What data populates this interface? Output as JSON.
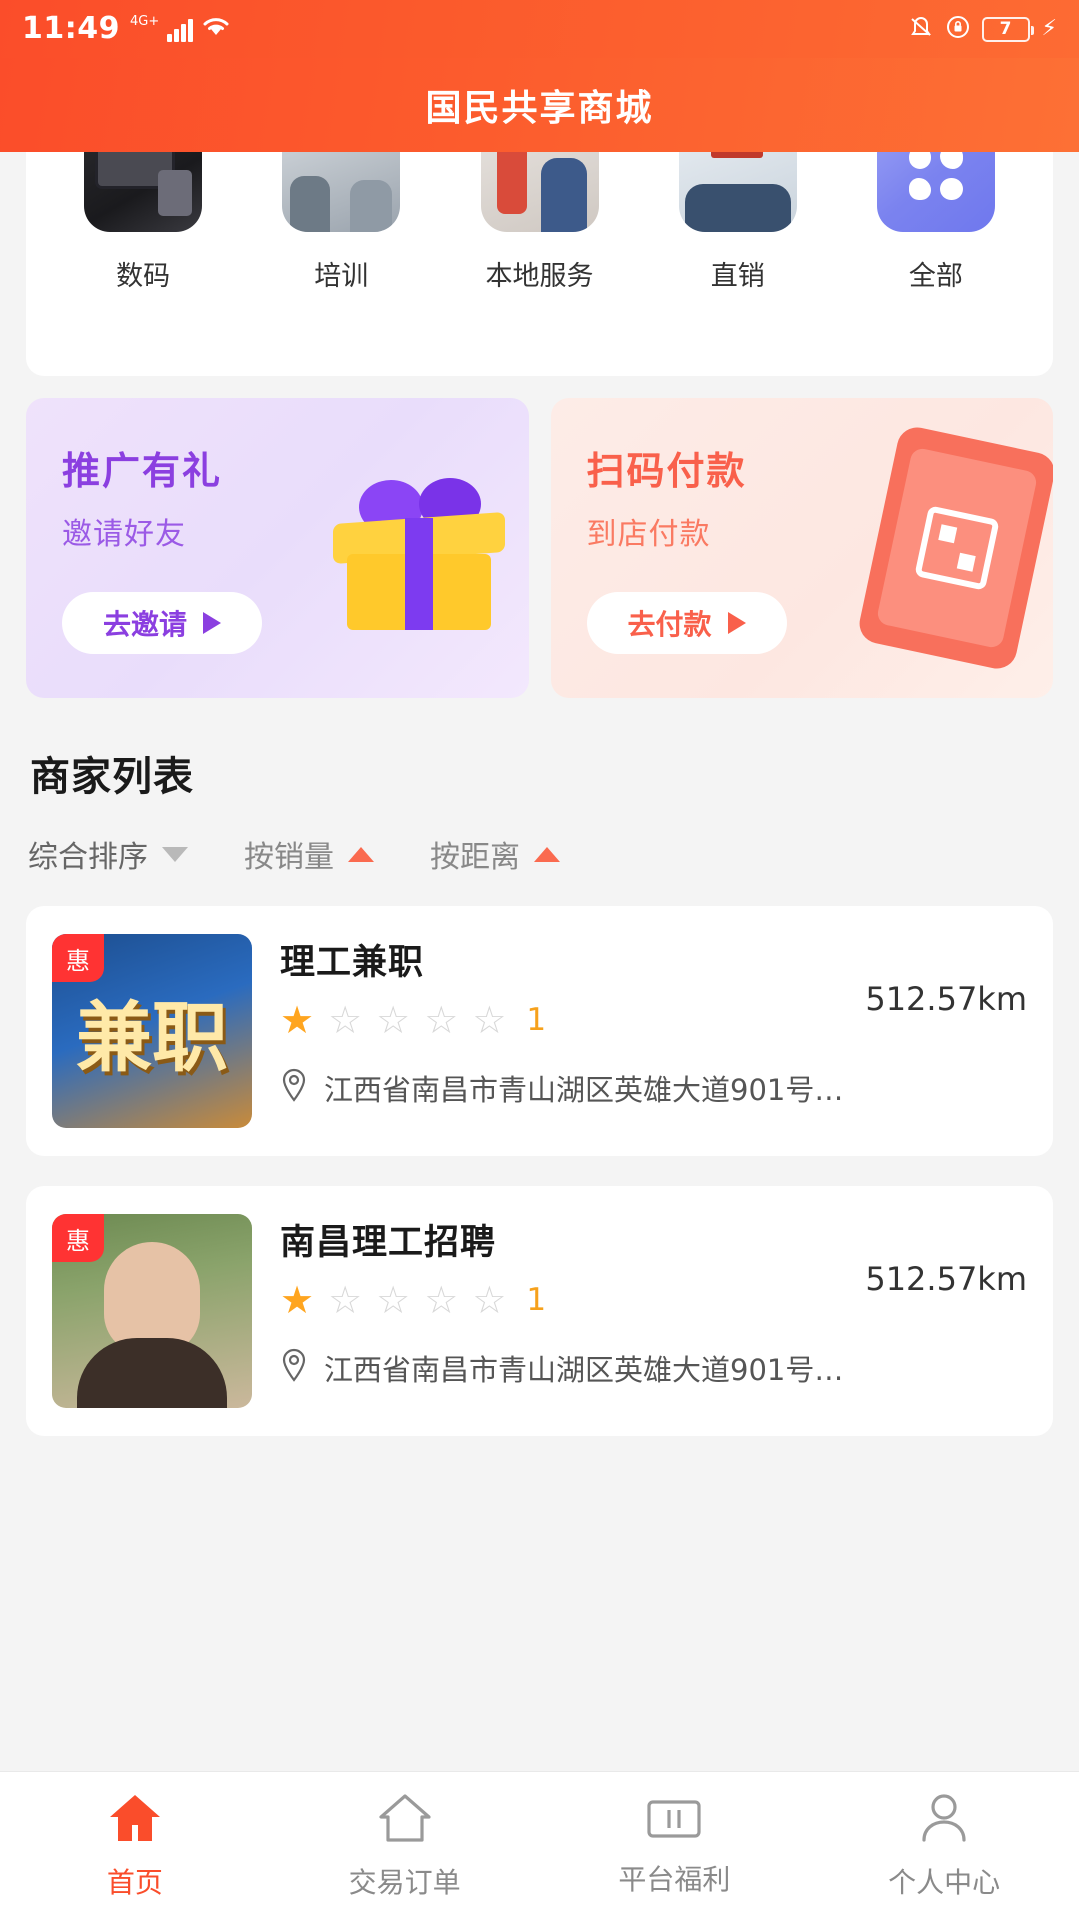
{
  "status_bar": {
    "time": "11:49",
    "network": "4G+",
    "battery_level": "7",
    "icons": [
      "signal-bars-icon",
      "wifi-icon",
      "vibrate-icon",
      "rotation-lock-icon",
      "battery-icon",
      "charging-bolt-icon"
    ]
  },
  "header": {
    "title": "国民共享商城"
  },
  "categories": [
    {
      "label": "数码",
      "icon": "digital-category-icon"
    },
    {
      "label": "培训",
      "icon": "training-category-icon"
    },
    {
      "label": "本地服务",
      "icon": "local-service-category-icon"
    },
    {
      "label": "直销",
      "icon": "direct-sales-category-icon"
    },
    {
      "label": "全部",
      "icon": "all-category-icon"
    }
  ],
  "banners": [
    {
      "title": "推广有礼",
      "subtitle": "邀请好友",
      "button": "去邀请",
      "art": "gift-box-icon"
    },
    {
      "title": "扫码付款",
      "subtitle": "到店付款",
      "button": "去付款",
      "art": "qr-phone-icon"
    }
  ],
  "merchant_section": {
    "title": "商家列表",
    "sorts": [
      {
        "label": "综合排序",
        "indicator": "caret-down"
      },
      {
        "label": "按销量",
        "indicator": "caret-up-red"
      },
      {
        "label": "按距离",
        "indicator": "caret-up-red"
      }
    ],
    "items": [
      {
        "badge": "惠",
        "name": "理工兼职",
        "rating": 1,
        "rating_text": "1",
        "distance": "512.57km",
        "address": "江西省南昌市青山湖区英雄大道901号…",
        "thumb": "job-poster-thumb",
        "thumb_text": "兼职"
      },
      {
        "badge": "惠",
        "name": "南昌理工招聘",
        "rating": 1,
        "rating_text": "1",
        "distance": "512.57km",
        "address": "江西省南昌市青山湖区英雄大道901号…",
        "thumb": "person-photo-thumb",
        "thumb_text": ""
      }
    ]
  },
  "tabbar": [
    {
      "label": "首页",
      "icon": "home-icon",
      "active": true
    },
    {
      "label": "交易订单",
      "icon": "order-home-icon",
      "active": false
    },
    {
      "label": "平台福利",
      "icon": "ticket-icon",
      "active": false
    },
    {
      "label": "个人中心",
      "icon": "person-icon",
      "active": false
    }
  ],
  "colors": {
    "brand": "#fb4d2a",
    "star": "#ffa51f",
    "promo": "#8b3fe0",
    "pay": "#f9604b"
  }
}
